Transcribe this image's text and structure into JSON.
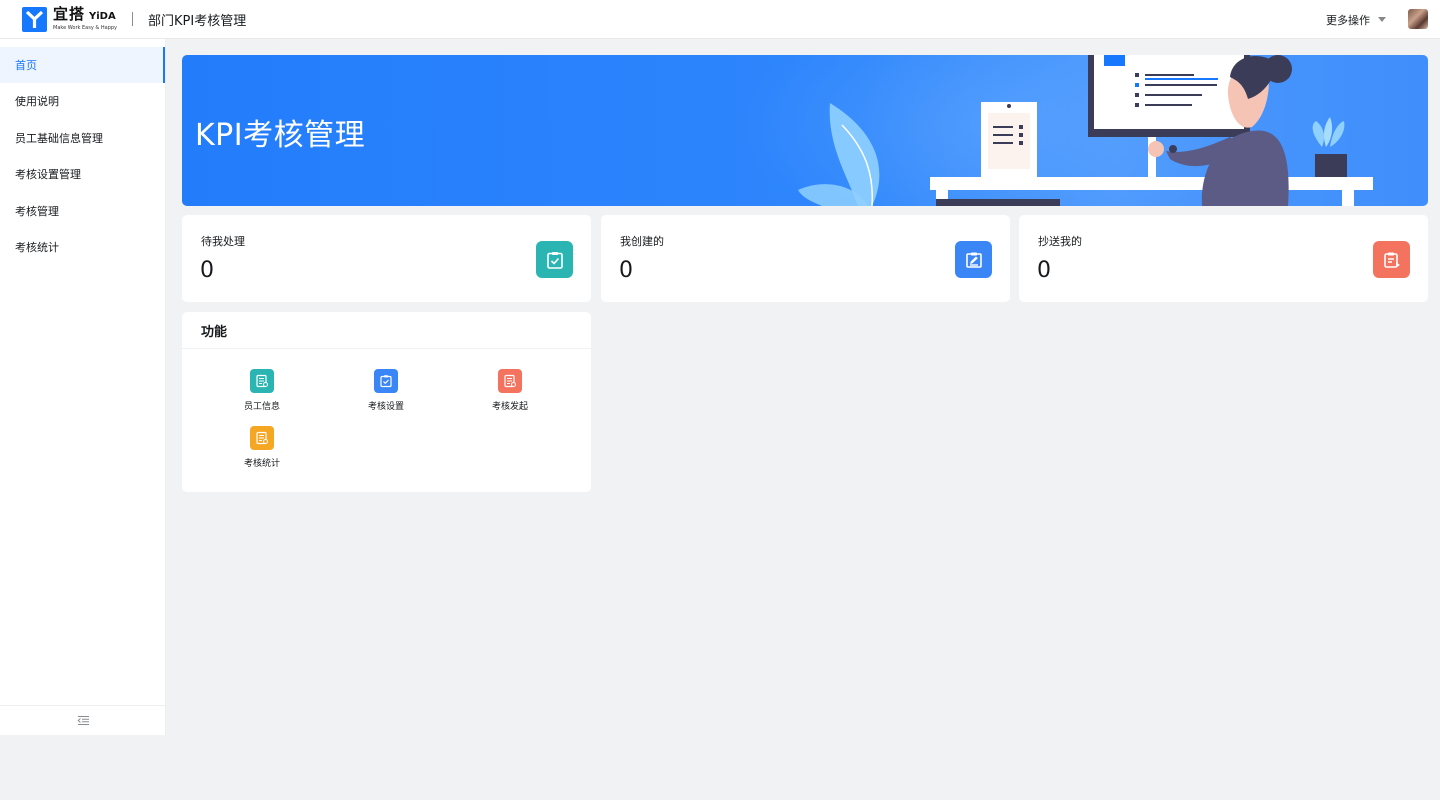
{
  "header": {
    "logo_cn": "宜搭",
    "logo_en": "YiDA",
    "logo_slogan": "Make Work Easy & Happy",
    "app_title": "部门KPI考核管理",
    "more_ops": "更多操作"
  },
  "sidebar": {
    "items": [
      {
        "label": "首页",
        "active": true
      },
      {
        "label": "使用说明"
      },
      {
        "label": "员工基础信息管理"
      },
      {
        "label": "考核设置管理"
      },
      {
        "label": "考核管理"
      },
      {
        "label": "考核统计"
      }
    ],
    "collapse_icon": "menu-fold-icon"
  },
  "banner": {
    "title": "KPI考核管理"
  },
  "stats": [
    {
      "label": "待我处理",
      "value": "0",
      "icon": "clipboard-check-icon",
      "color": "#2ab5b2"
    },
    {
      "label": "我创建的",
      "value": "0",
      "icon": "edit-note-icon",
      "color": "#3a86f6"
    },
    {
      "label": "抄送我的",
      "value": "0",
      "icon": "copy-send-icon",
      "color": "#f3735f"
    }
  ],
  "functions": {
    "title": "功能",
    "items": [
      {
        "label": "员工信息",
        "icon": "document-icon",
        "color": "#2ab5b2"
      },
      {
        "label": "考核设置",
        "icon": "clipboard-check-icon",
        "color": "#3a86f6"
      },
      {
        "label": "考核发起",
        "icon": "document-icon",
        "color": "#f3735f"
      },
      {
        "label": "考核统计",
        "icon": "document-icon",
        "color": "#f5a623"
      }
    ]
  },
  "colors": {
    "accent": "#1677ff",
    "banner": "#237dfb",
    "background": "#f1f2f4"
  }
}
